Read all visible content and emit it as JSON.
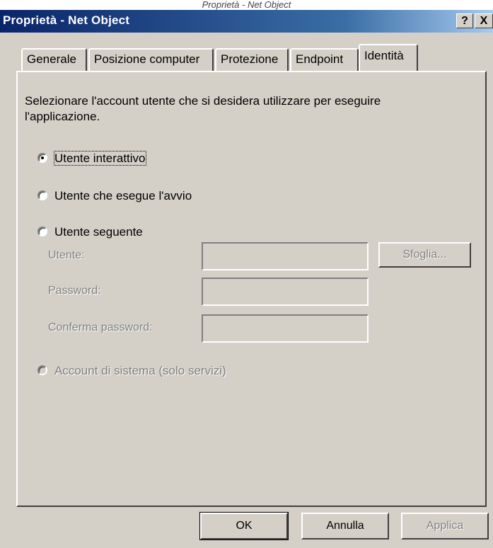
{
  "caption": "Proprietà - Net Object",
  "window": {
    "title": "Proprietà - Net Object",
    "help_glyph": "?",
    "close_glyph": "X"
  },
  "tabs": [
    {
      "label": "Generale",
      "active": false
    },
    {
      "label": "Posizione computer",
      "active": false
    },
    {
      "label": "Protezione",
      "active": false
    },
    {
      "label": "Endpoint",
      "active": false
    },
    {
      "label": "Identità",
      "active": true
    }
  ],
  "identity": {
    "description": "Selezionare l'account utente che si desidera utilizzare per eseguire l'applicazione.",
    "options": {
      "interactive": {
        "label": "Utente interattivo",
        "checked": true
      },
      "launching": {
        "label": "Utente che esegue l'avvio",
        "checked": false
      },
      "specific": {
        "label": "Utente seguente",
        "checked": false
      },
      "system": {
        "label": "Account di sistema (solo servizi)",
        "checked": false,
        "disabled": true
      }
    },
    "fields": {
      "user_label": "Utente:",
      "user_value": "",
      "password_label": "Password:",
      "password_value": "",
      "confirm_label": "Conferma password:",
      "confirm_value": ""
    },
    "browse_label": "Sfoglia..."
  },
  "footer": {
    "ok_label": "OK",
    "cancel_label": "Annulla",
    "apply_label": "Applica"
  },
  "colors": {
    "face": "#d4d0c8",
    "titlebar_start": "#0a246a",
    "titlebar_end": "#a6caf0",
    "disabled_text": "#808080"
  }
}
